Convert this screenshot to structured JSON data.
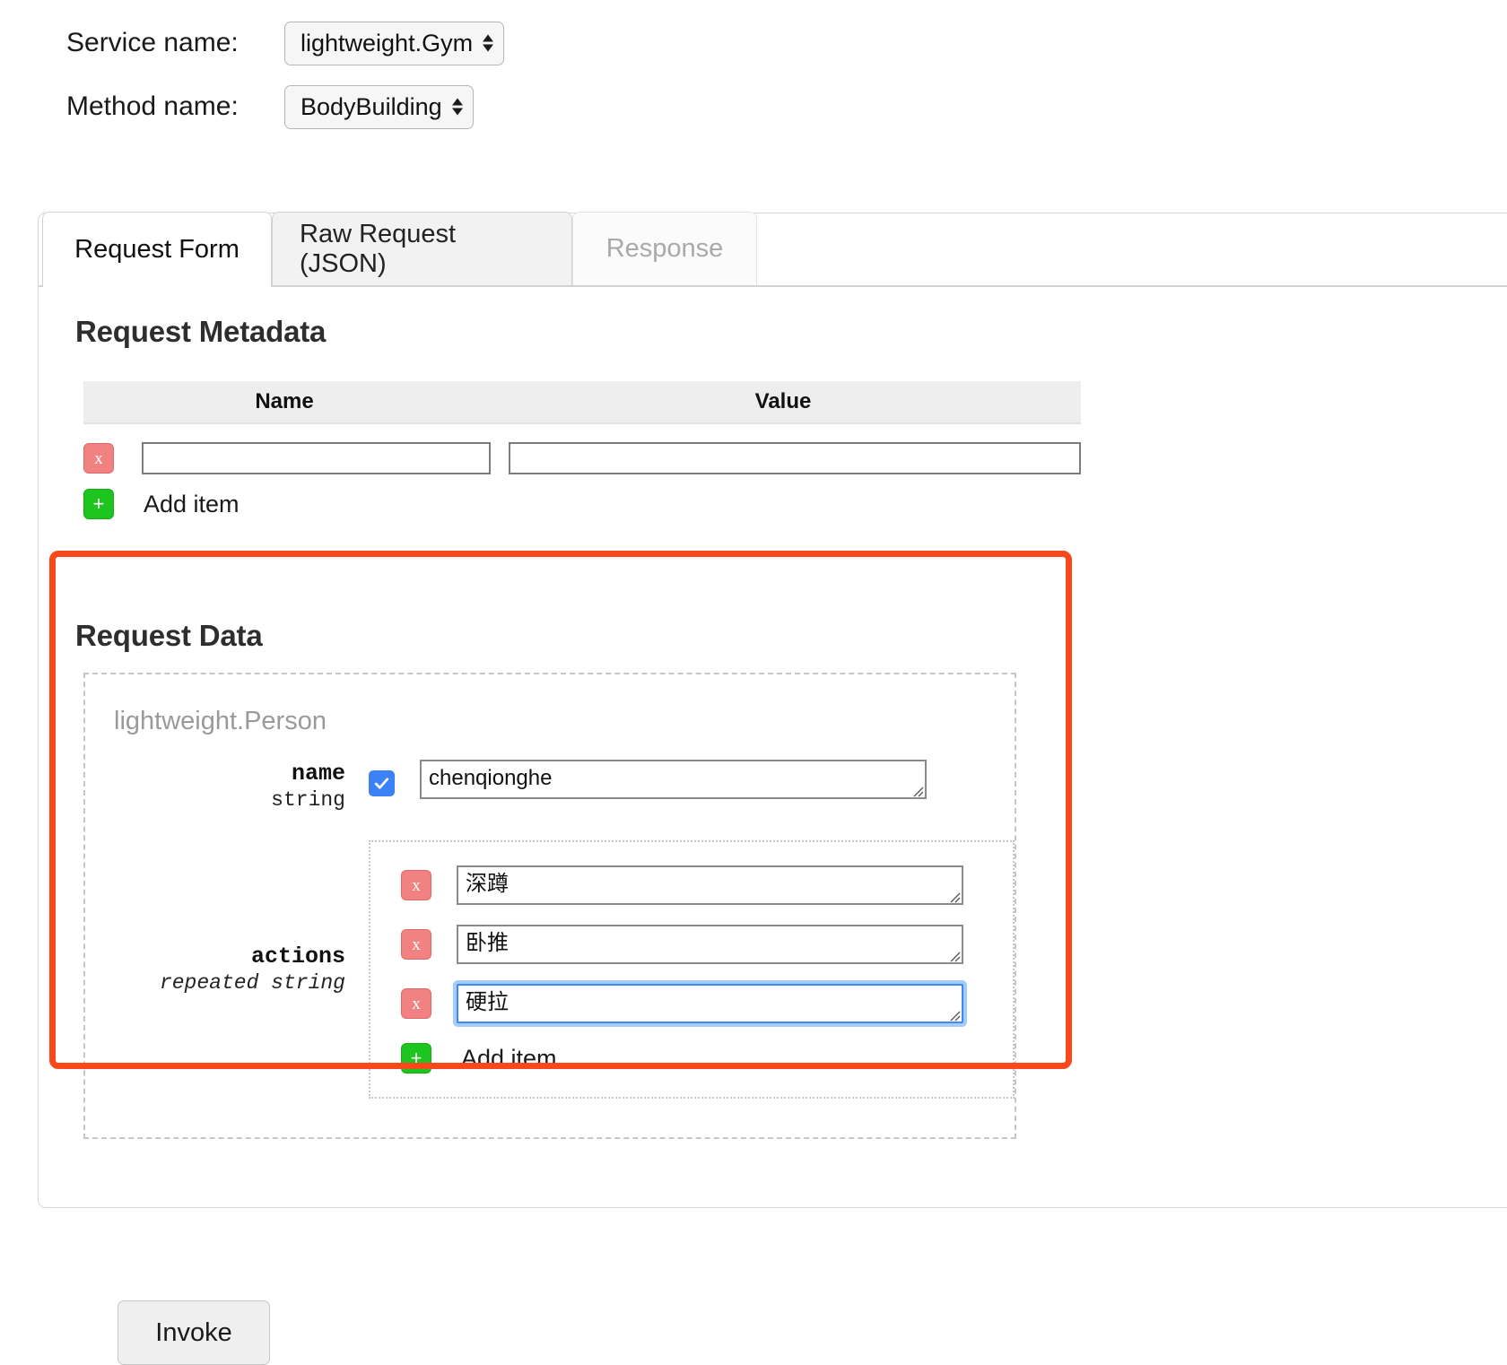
{
  "top_form": {
    "service": {
      "label": "Service name:",
      "selected": "lightweight.Gym"
    },
    "method": {
      "label": "Method name:",
      "selected": "BodyBuilding"
    }
  },
  "tabs": [
    {
      "label": "Request Form",
      "state": "active"
    },
    {
      "label": "Raw Request (JSON)",
      "state": "inactive"
    },
    {
      "label": "Response",
      "state": "disabled"
    }
  ],
  "request_metadata": {
    "heading": "Request Metadata",
    "columns": {
      "name": "Name",
      "value": "Value"
    },
    "rows": [
      {
        "remove_label": "x",
        "name": "",
        "value": ""
      }
    ],
    "add_item": {
      "icon_label": "+",
      "label": "Add item"
    }
  },
  "request_data": {
    "heading": "Request Data",
    "message_type": "lightweight.Person",
    "fields": [
      {
        "name": "name",
        "type": "string",
        "checked": true,
        "value": "chenqionghe"
      },
      {
        "name": "actions",
        "type": "repeated string",
        "items": [
          {
            "remove_label": "x",
            "value": "深蹲",
            "focused": false
          },
          {
            "remove_label": "x",
            "value": "卧推",
            "focused": false
          },
          {
            "remove_label": "x",
            "value": "硬拉",
            "focused": true
          }
        ],
        "add_item": {
          "icon_label": "+",
          "label": "Add item"
        }
      }
    ]
  },
  "invoke_button": {
    "label": "Invoke"
  },
  "annotation": {
    "color": "#f8481c"
  }
}
